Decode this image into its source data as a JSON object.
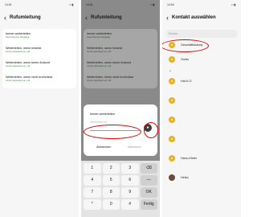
{
  "screen1": {
    "time": "14:51",
    "title": "Rufumleitung",
    "items": [
      {
        "label": "Immer weiterleiten",
        "sub": "Keine Nummer festgelegt"
      },
      {
        "label": "Weiterleiten, wenn besetzt",
        "sub": "Anrufe weiterleiten an +49"
      },
      {
        "label": "Weiterleiten, wenn keine Antwort",
        "sub": "Anrufe weiterleiten an +49"
      },
      {
        "label": "Weiterleiten, wenn nicht erreichbar",
        "sub": "Anrufe weiterleiten an +49"
      }
    ]
  },
  "screen2": {
    "time": "14:51",
    "title": "Rufumleitung",
    "items": [
      {
        "label": "Immer weiterleiten",
        "sub": "Keine Nummer festgelegt"
      },
      {
        "label": "Weiterleiten, wenn besetzt",
        "sub": "Anrufe weiterleiten an +49"
      },
      {
        "label": "Weiterleiten, wenn keine Antwort",
        "sub": "Anrufe weiterleiten an +49"
      },
      {
        "label": "Weiterleiten, wenn nicht erreichbar",
        "sub": "Anrufe weiterleiten an +49"
      }
    ],
    "dialog": {
      "title": "Immer weiterleiten",
      "placeholder": "Weiterleiten an",
      "cancel": "Abbrechen",
      "activate": "Aktivieren"
    },
    "keypad": [
      "1",
      "2",
      "3",
      "⌫",
      "4",
      "5",
      "6",
      "—",
      "7",
      "8",
      "9",
      "OK",
      "*",
      "0",
      "#",
      "Fertig"
    ]
  },
  "screen3": {
    "time": "14:54",
    "title": "Kontakt auswählen",
    "search_placeholder": "Suche",
    "sections": [
      {
        "letter": "G",
        "contacts": [
          "Geschäftshandy",
          "Guido"
        ]
      },
      {
        "letter": "H",
        "contacts": [
          "Hai-K.O.",
          "",
          "",
          "",
          "Hans-Dieter",
          "Heiko"
        ]
      }
    ]
  },
  "colors": {
    "accent": "#e8b126",
    "highlight": "#e00000"
  }
}
